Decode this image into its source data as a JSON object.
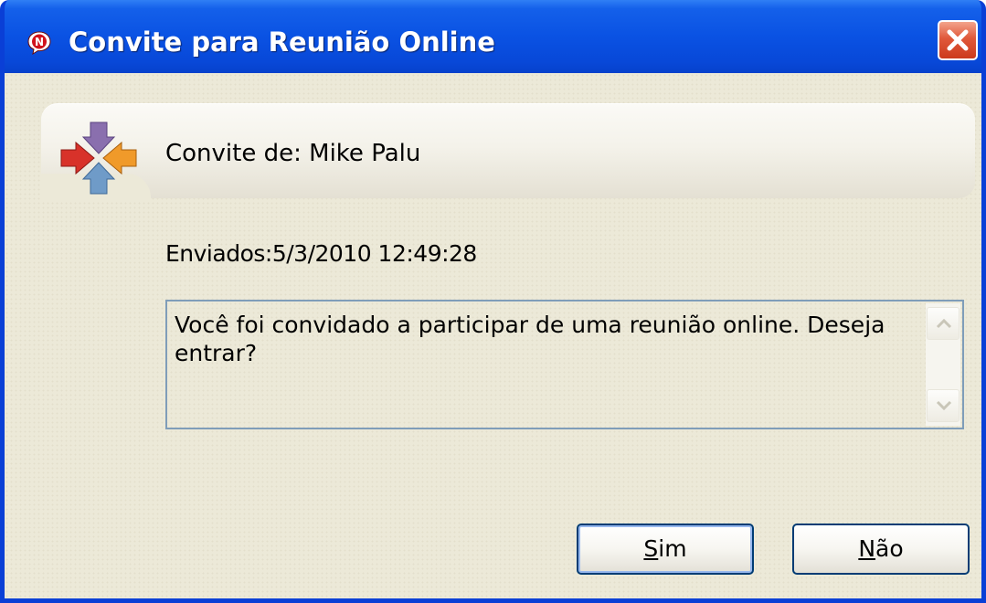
{
  "window": {
    "title": "Convite para Reunião Online",
    "app_icon": "novell-n-icon",
    "close_icon": "close-x-icon"
  },
  "invite": {
    "icon": "meeting-arrows-icon",
    "from_label": "Convite de:",
    "from_name": "Mike Palu",
    "sent_label": "Enviados:",
    "sent_datetime": "5/3/2010 12:49:28",
    "message": "Você foi convidado a participar de uma reunião online. Deseja entrar?"
  },
  "buttons": {
    "yes_mnemonic": "S",
    "yes_rest": "im",
    "no_mnemonic": "N",
    "no_rest": "ão"
  },
  "colors": {
    "titlebar": "#0a52e3",
    "window_bg": "#ece9d8",
    "close_button": "#e0583a",
    "field_border": "#7f9db9"
  }
}
